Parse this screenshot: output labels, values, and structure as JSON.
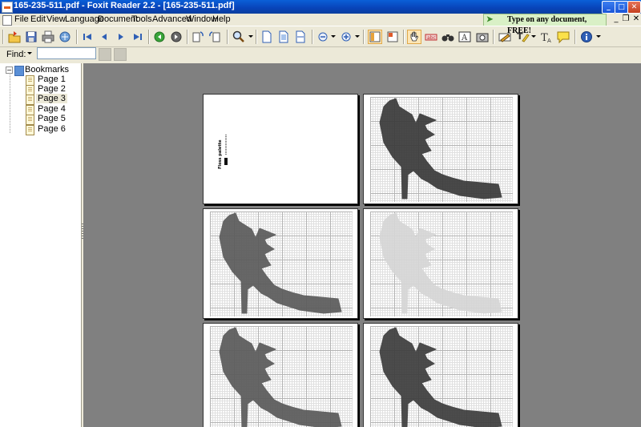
{
  "window": {
    "title": "165-235-511.pdf - Foxit Reader 2.2 - [165-235-511.pdf]",
    "controls": [
      "minimize",
      "maximize",
      "close"
    ]
  },
  "menubar": {
    "items": [
      "File",
      "Edit",
      "View",
      "Language",
      "Document",
      "Tools",
      "Advanced",
      "Window",
      "Help"
    ],
    "promo": "Type on any document, FREE!"
  },
  "toolbar": {
    "buttons": [
      "open-icon",
      "save-icon",
      "print-icon",
      "email-icon",
      "first-page-icon",
      "previous-page-icon",
      "next-page-icon",
      "last-page-icon",
      "go-back-icon",
      "go-forward-icon",
      "rotate-left-icon",
      "rotate-right-icon",
      "zoom-icon",
      "actual-size-icon",
      "fit-page-icon",
      "fit-width-icon",
      "zoom-out-icon",
      "zoom-in-icon",
      "bookmark-panel-icon",
      "thumbnail-icon",
      "hand-tool-icon",
      "select-text-icon",
      "find-icon",
      "typewriter-icon",
      "snapshot-icon",
      "pencil-icon",
      "highlight-icon",
      "text-tool-icon",
      "note-icon",
      "info-icon"
    ]
  },
  "findbar": {
    "label": "Find:",
    "value": ""
  },
  "bookmarks": {
    "root": "Bookmarks",
    "items": [
      {
        "label": "Page 1",
        "selected": false
      },
      {
        "label": "Page 2",
        "selected": false
      },
      {
        "label": "Page 3",
        "selected": true
      },
      {
        "label": "Page 4",
        "selected": false
      },
      {
        "label": "Page 5",
        "selected": false
      },
      {
        "label": "Page 6",
        "selected": false
      }
    ]
  },
  "pages": {
    "page1_legend": "Floss palette",
    "shoe_colors": [
      "#3a3a3a",
      "#5b5b5b",
      "#d6d6d6",
      "#5a5a5a",
      "#3d3d3d"
    ]
  }
}
